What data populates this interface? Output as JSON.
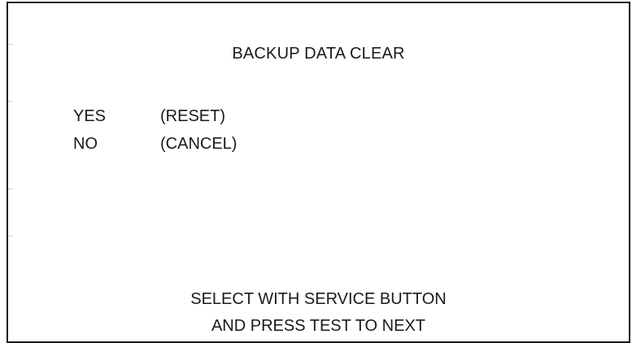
{
  "screen": {
    "title": "BACKUP DATA CLEAR",
    "options": [
      {
        "key": "YES",
        "action": "(RESET)"
      },
      {
        "key": "NO",
        "action": "(CANCEL)"
      }
    ],
    "instructions": [
      "SELECT WITH SERVICE BUTTON",
      "AND PRESS TEST TO NEXT"
    ]
  },
  "colors": {
    "text": "#1a1a1a",
    "background": "#ffffff",
    "border": "#1a1a1a"
  }
}
